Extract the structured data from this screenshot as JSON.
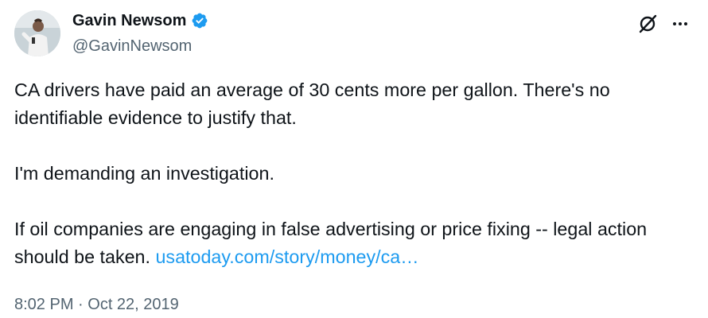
{
  "author": {
    "display_name": "Gavin Newsom",
    "handle": "@GavinNewsom",
    "verified": true
  },
  "header_actions": {
    "grok_icon": "grok-icon",
    "more_icon": "more-icon"
  },
  "tweet": {
    "line1": "CA drivers have paid an average of 30 cents more per gallon. There's no identifiable evidence to justify that.",
    "line2": "I'm demanding an investigation.",
    "line3": "If oil companies are engaging in false advertising or price fixing -- legal action should be taken.",
    "link_text": "usatoday.com/story/money/ca…",
    "timestamp": "8:02 PM · Oct 22, 2019"
  },
  "colors": {
    "text": "#0f1419",
    "secondary": "#536471",
    "link": "#1d9bf0",
    "verified": "#1d9bf0"
  }
}
